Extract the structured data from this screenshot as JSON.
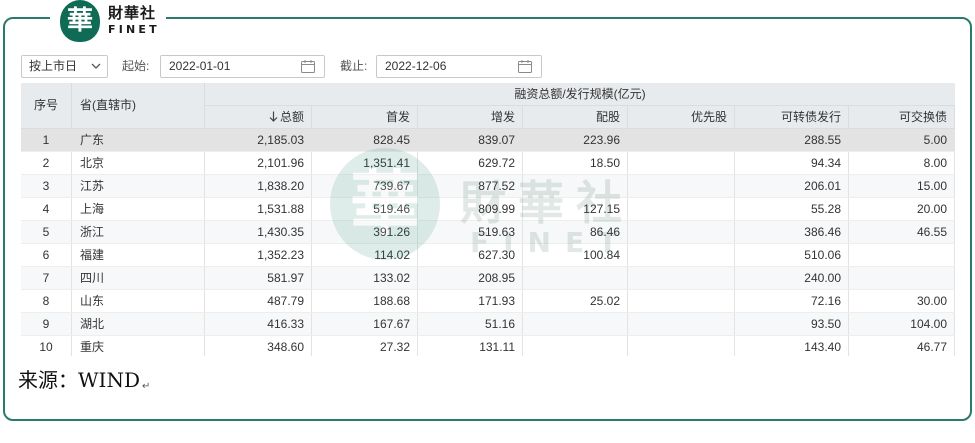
{
  "colors": {
    "brand": "#0f6b55",
    "frame": "#2a7b6b",
    "header_bg": "#e8ebee",
    "selected_row_bg": "#e3e3e3"
  },
  "brand": {
    "badge_char": "華",
    "name_cn": "財華社",
    "name_en": "FINET"
  },
  "toolbar": {
    "date_type": {
      "selected": "按上市日",
      "icon": "chevron-down-icon"
    },
    "start": {
      "label": "起始:",
      "value": "2022-01-01",
      "icon": "calendar-icon"
    },
    "end": {
      "label": "截止:",
      "value": "2022-12-06",
      "icon": "calendar-icon"
    }
  },
  "table": {
    "headers": {
      "index": "序号",
      "province": "省(直辖市)",
      "group": "融资总额/发行规模(亿元)",
      "columns": [
        "总额",
        "首发",
        "增发",
        "配股",
        "优先股",
        "可转债发行",
        "可交换债"
      ],
      "sorted_column": 0,
      "sort_icon": "arrow-down-icon"
    },
    "selected_row": 0,
    "rows": [
      {
        "index": "1",
        "province": "广东",
        "values": [
          "2,185.03",
          "828.45",
          "839.07",
          "223.96",
          "",
          "288.55",
          "5.00"
        ]
      },
      {
        "index": "2",
        "province": "北京",
        "values": [
          "2,101.96",
          "1,351.41",
          "629.72",
          "18.50",
          "",
          "94.34",
          "8.00"
        ]
      },
      {
        "index": "3",
        "province": "江苏",
        "values": [
          "1,838.20",
          "739.67",
          "877.52",
          "",
          "",
          "206.01",
          "15.00"
        ]
      },
      {
        "index": "4",
        "province": "上海",
        "values": [
          "1,531.88",
          "519.46",
          "809.99",
          "127.15",
          "",
          "55.28",
          "20.00"
        ]
      },
      {
        "index": "5",
        "province": "浙江",
        "values": [
          "1,430.35",
          "391.26",
          "519.63",
          "86.46",
          "",
          "386.46",
          "46.55"
        ]
      },
      {
        "index": "6",
        "province": "福建",
        "values": [
          "1,352.23",
          "114.02",
          "627.30",
          "100.84",
          "",
          "510.06",
          ""
        ]
      },
      {
        "index": "7",
        "province": "四川",
        "values": [
          "581.97",
          "133.02",
          "208.95",
          "",
          "",
          "240.00",
          ""
        ]
      },
      {
        "index": "8",
        "province": "山东",
        "values": [
          "487.79",
          "188.68",
          "171.93",
          "25.02",
          "",
          "72.16",
          "30.00"
        ]
      },
      {
        "index": "9",
        "province": "湖北",
        "values": [
          "416.33",
          "167.67",
          "51.16",
          "",
          "",
          "93.50",
          "104.00"
        ]
      },
      {
        "index": "10",
        "province": "重庆",
        "values": [
          "348.60",
          "27.32",
          "131.11",
          "",
          "",
          "143.40",
          "46.77"
        ]
      }
    ]
  },
  "watermark": {
    "badge_char": "華",
    "name_cn": "財華社",
    "name_en": "FINET"
  },
  "footer": {
    "source": "来源：WIND",
    "paragraph_mark": "↵"
  }
}
